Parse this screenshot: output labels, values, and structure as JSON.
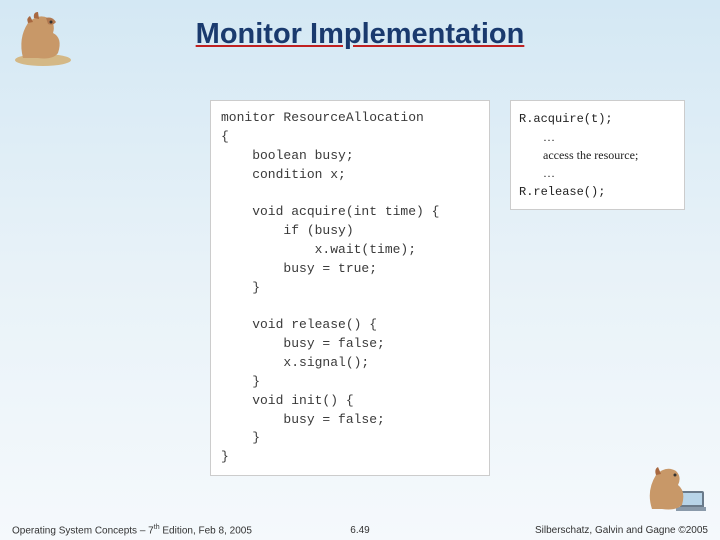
{
  "title": "Monitor Implementation",
  "code_left": "monitor ResourceAllocation\n{\n    boolean busy;\n    condition x;\n\n    void acquire(int time) {\n        if (busy)\n            x.wait(time);\n        busy = true;\n    }\n\n    void release() {\n        busy = false;\n        x.signal();\n    }\n    void init() {\n        busy = false;\n    }\n}",
  "code_right": {
    "l1": "R.acquire(t);",
    "l2": "…",
    "l3": "access the resource;",
    "l4": "…",
    "l5": "R.release();"
  },
  "footer": {
    "left_a": "Operating System Concepts – 7",
    "left_sup": "th",
    "left_b": " Edition, Feb 8, 2005",
    "center": "6.49",
    "right": "Silberschatz, Galvin and Gagne ©2005"
  }
}
